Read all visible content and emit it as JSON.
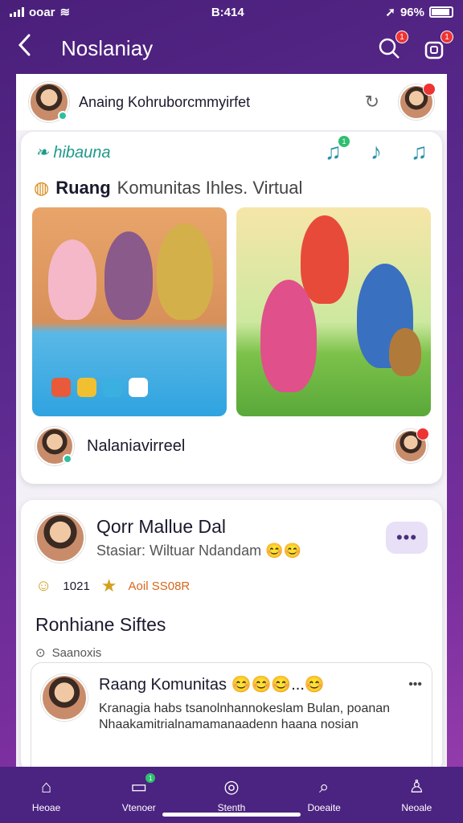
{
  "status_bar": {
    "carrier": "ooar",
    "time": "B:414",
    "battery": "96%"
  },
  "app_bar": {
    "title": "Noslaniay",
    "search_badge": "1",
    "notif_badge": "1"
  },
  "top_row": {
    "text": "Anaing Kohruborcmmyirfet"
  },
  "room_card": {
    "brand": "hibauna",
    "music_badge": "1",
    "title_bold": "Ruang",
    "title_rest": "Komunitas Ihles. Virtual",
    "footer_name": "Nalaniavirreel"
  },
  "post_card": {
    "author": "Qorr Mallue Dal",
    "subtitle": "Stasiar: Wiltuar Ndandam 😊😊",
    "stat_count": "1021",
    "stat_hot": "Aoil SS08R",
    "section_title": "Ronhiane Siftes",
    "saved_label": "Saanoxis",
    "sub_title": "Raang Komunitas 😊😊😊...😊",
    "sub_text": "Kranagia habs tsanolnhannokeslam Bulan, poanan Nhaakamitrialnamamanaadenn haana nosian"
  },
  "bottom_nav": [
    {
      "label": "Heoae",
      "icon": "home-icon"
    },
    {
      "label": "Vtenoer",
      "icon": "inbox-icon",
      "badge": "1"
    },
    {
      "label": "Stenth",
      "icon": "circle-icon"
    },
    {
      "label": "Doeaite",
      "icon": "search-icon"
    },
    {
      "label": "Neoale",
      "icon": "profile-icon"
    }
  ],
  "colors": {
    "primary": "#4b2380",
    "accent": "#2fbf9f",
    "badge": "#e33"
  }
}
